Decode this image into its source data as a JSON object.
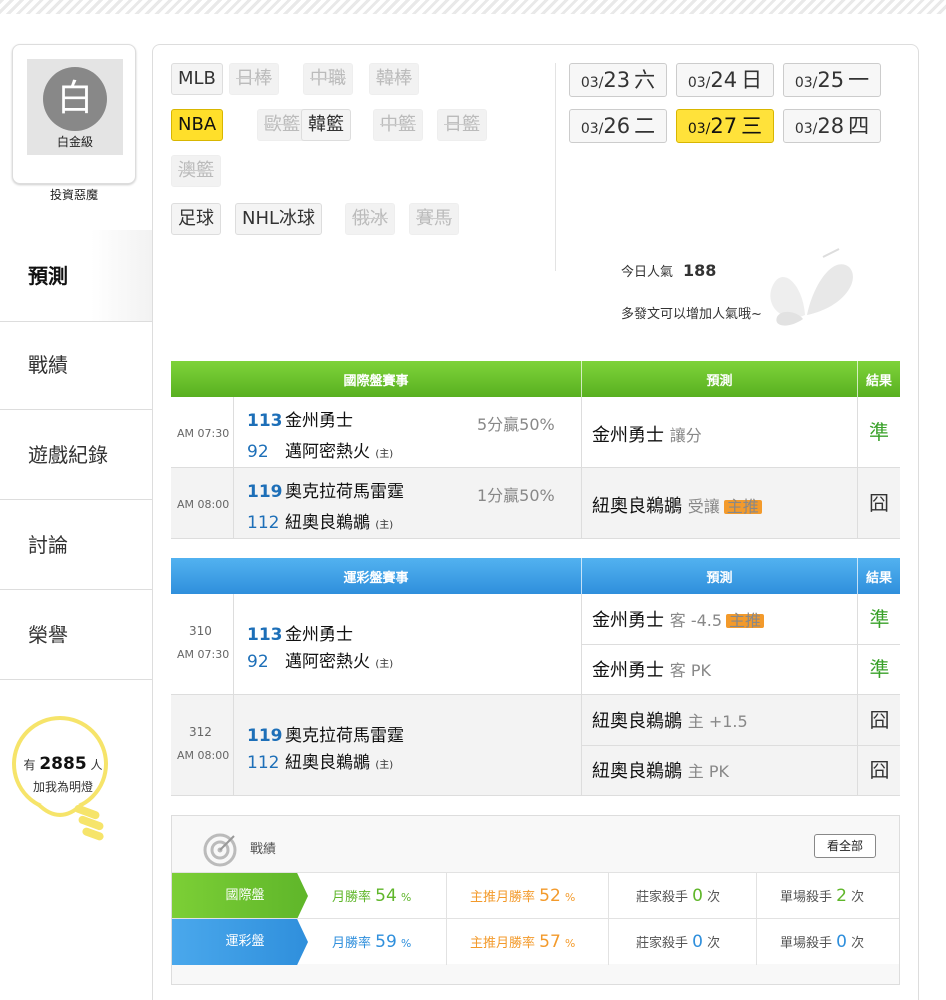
{
  "profile": {
    "avatar_char": "白",
    "level": "白金級",
    "username": "投資惡魔"
  },
  "nav": {
    "predict": "預測",
    "record": "戰績",
    "games": "遊戲紀錄",
    "discuss": "討論",
    "honor": "榮譽"
  },
  "fans": {
    "prefix": "有",
    "count": "2885",
    "suffix": "人",
    "line2": "加我為明燈"
  },
  "sports": [
    {
      "label": "MLB",
      "state": "normal"
    },
    {
      "label": "日棒",
      "state": "disabled"
    },
    {
      "label": "中職",
      "state": "disabled"
    },
    {
      "label": "韓棒",
      "state": "disabled"
    },
    {
      "label": "NBA",
      "state": "active"
    },
    {
      "label": "歐籃",
      "state": "disabled"
    },
    {
      "label": "韓籃",
      "state": "normal"
    },
    {
      "label": "中籃",
      "state": "disabled"
    },
    {
      "label": "日籃",
      "state": "disabled"
    },
    {
      "label": "澳籃",
      "state": "disabled"
    },
    {
      "label": "足球",
      "state": "normal"
    },
    {
      "label": "NHL冰球",
      "state": "normal"
    },
    {
      "label": "俄冰",
      "state": "disabled"
    },
    {
      "label": "賽馬",
      "state": "disabled"
    }
  ],
  "dates": [
    {
      "md": "03/",
      "day": "23",
      "wd": "六",
      "active": false
    },
    {
      "md": "03/",
      "day": "24",
      "wd": "日",
      "active": false
    },
    {
      "md": "03/",
      "day": "25",
      "wd": "一",
      "active": false
    },
    {
      "md": "03/",
      "day": "26",
      "wd": "二",
      "active": false
    },
    {
      "md": "03/",
      "day": "27",
      "wd": "三",
      "active": true
    },
    {
      "md": "03/",
      "day": "28",
      "wd": "四",
      "active": false
    }
  ],
  "popularity": {
    "label": "今日人氣",
    "value": "188",
    "tip": "多發文可以增加人氣哦~"
  },
  "intl": {
    "header": {
      "game": "國際盤賽事",
      "pick": "預測",
      "result": "結果"
    },
    "rows": [
      {
        "time": "AM 07:30",
        "s1": "113",
        "t1": "金州勇士",
        "s2": "92",
        "t2": "邁阿密熱火",
        "home": "(主)",
        "odds": "5分贏50%",
        "pick_team": "金州勇士",
        "pick_type": "讓分",
        "main": false,
        "result": "準"
      },
      {
        "time": "AM 08:00",
        "s1": "119",
        "t1": "奧克拉荷馬雷霆",
        "s2": "112",
        "t2": "紐奧良鵜鶘",
        "home": "(主)",
        "odds": "1分贏50%",
        "pick_team": "紐奧良鵜鶘",
        "pick_type": "受讓",
        "main": true,
        "result": "囧"
      }
    ]
  },
  "sport_lottery": {
    "header": {
      "game": "運彩盤賽事",
      "pick": "預測",
      "result": "結果"
    },
    "rows": [
      {
        "no": "310",
        "time": "AM 07:30",
        "s1": "113",
        "t1": "金州勇士",
        "s2": "92",
        "t2": "邁阿密熱火",
        "home": "(主)",
        "picks": [
          {
            "team": "金州勇士",
            "type": "客 -4.5",
            "main": true,
            "result": "準"
          },
          {
            "team": "金州勇士",
            "type": "客 PK",
            "main": false,
            "result": "準"
          }
        ]
      },
      {
        "no": "312",
        "time": "AM 08:00",
        "s1": "119",
        "t1": "奧克拉荷馬雷霆",
        "s2": "112",
        "t2": "紐奧良鵜鶘",
        "home": "(主)",
        "picks": [
          {
            "team": "紐奧良鵜鶘",
            "type": "主 +1.5",
            "main": false,
            "result": "囧"
          },
          {
            "team": "紐奧良鵜鶘",
            "type": "主 PK",
            "main": false,
            "result": "囧"
          }
        ]
      }
    ]
  },
  "badge_label": "主推",
  "stats": {
    "title": "戰績",
    "view_all": "看全部",
    "rows": [
      {
        "label": "國際盤",
        "month_label": "月勝率",
        "month_val": "54",
        "main_label": "主推月勝率",
        "main_val": "52",
        "pct": "%",
        "banker_label": "莊家殺手",
        "banker_val": "0",
        "single_label": "單場殺手",
        "single_val": "2",
        "unit": "次"
      },
      {
        "label": "運彩盤",
        "month_label": "月勝率",
        "month_val": "59",
        "main_label": "主推月勝率",
        "main_val": "57",
        "pct": "%",
        "banker_label": "莊家殺手",
        "banker_val": "0",
        "single_label": "單場殺手",
        "single_val": "0",
        "unit": "次"
      }
    ]
  },
  "colors": {
    "green": "#5fb62a",
    "blue": "#2f8fdc",
    "active_yellow": "#ffdf2a",
    "orange": "#f39a2b",
    "win": "#3aa22a"
  }
}
